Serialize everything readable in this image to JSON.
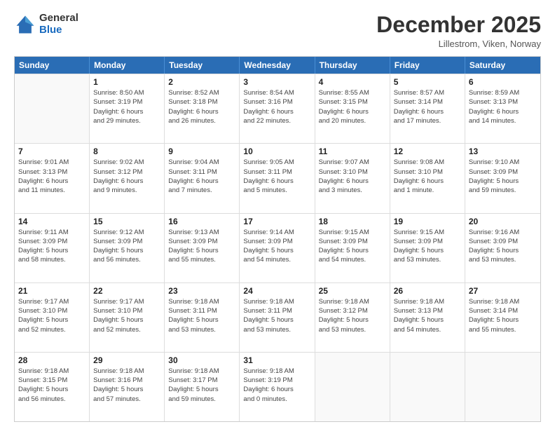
{
  "header": {
    "logo_general": "General",
    "logo_blue": "Blue",
    "month_title": "December 2025",
    "location": "Lillestrom, Viken, Norway"
  },
  "calendar": {
    "days_of_week": [
      "Sunday",
      "Monday",
      "Tuesday",
      "Wednesday",
      "Thursday",
      "Friday",
      "Saturday"
    ],
    "weeks": [
      [
        {
          "day": "",
          "info": ""
        },
        {
          "day": "1",
          "info": "Sunrise: 8:50 AM\nSunset: 3:19 PM\nDaylight: 6 hours\nand 29 minutes."
        },
        {
          "day": "2",
          "info": "Sunrise: 8:52 AM\nSunset: 3:18 PM\nDaylight: 6 hours\nand 26 minutes."
        },
        {
          "day": "3",
          "info": "Sunrise: 8:54 AM\nSunset: 3:16 PM\nDaylight: 6 hours\nand 22 minutes."
        },
        {
          "day": "4",
          "info": "Sunrise: 8:55 AM\nSunset: 3:15 PM\nDaylight: 6 hours\nand 20 minutes."
        },
        {
          "day": "5",
          "info": "Sunrise: 8:57 AM\nSunset: 3:14 PM\nDaylight: 6 hours\nand 17 minutes."
        },
        {
          "day": "6",
          "info": "Sunrise: 8:59 AM\nSunset: 3:13 PM\nDaylight: 6 hours\nand 14 minutes."
        }
      ],
      [
        {
          "day": "7",
          "info": "Sunrise: 9:01 AM\nSunset: 3:13 PM\nDaylight: 6 hours\nand 11 minutes."
        },
        {
          "day": "8",
          "info": "Sunrise: 9:02 AM\nSunset: 3:12 PM\nDaylight: 6 hours\nand 9 minutes."
        },
        {
          "day": "9",
          "info": "Sunrise: 9:04 AM\nSunset: 3:11 PM\nDaylight: 6 hours\nand 7 minutes."
        },
        {
          "day": "10",
          "info": "Sunrise: 9:05 AM\nSunset: 3:11 PM\nDaylight: 6 hours\nand 5 minutes."
        },
        {
          "day": "11",
          "info": "Sunrise: 9:07 AM\nSunset: 3:10 PM\nDaylight: 6 hours\nand 3 minutes."
        },
        {
          "day": "12",
          "info": "Sunrise: 9:08 AM\nSunset: 3:10 PM\nDaylight: 6 hours\nand 1 minute."
        },
        {
          "day": "13",
          "info": "Sunrise: 9:10 AM\nSunset: 3:09 PM\nDaylight: 5 hours\nand 59 minutes."
        }
      ],
      [
        {
          "day": "14",
          "info": "Sunrise: 9:11 AM\nSunset: 3:09 PM\nDaylight: 5 hours\nand 58 minutes."
        },
        {
          "day": "15",
          "info": "Sunrise: 9:12 AM\nSunset: 3:09 PM\nDaylight: 5 hours\nand 56 minutes."
        },
        {
          "day": "16",
          "info": "Sunrise: 9:13 AM\nSunset: 3:09 PM\nDaylight: 5 hours\nand 55 minutes."
        },
        {
          "day": "17",
          "info": "Sunrise: 9:14 AM\nSunset: 3:09 PM\nDaylight: 5 hours\nand 54 minutes."
        },
        {
          "day": "18",
          "info": "Sunrise: 9:15 AM\nSunset: 3:09 PM\nDaylight: 5 hours\nand 54 minutes."
        },
        {
          "day": "19",
          "info": "Sunrise: 9:15 AM\nSunset: 3:09 PM\nDaylight: 5 hours\nand 53 minutes."
        },
        {
          "day": "20",
          "info": "Sunrise: 9:16 AM\nSunset: 3:09 PM\nDaylight: 5 hours\nand 53 minutes."
        }
      ],
      [
        {
          "day": "21",
          "info": "Sunrise: 9:17 AM\nSunset: 3:10 PM\nDaylight: 5 hours\nand 52 minutes."
        },
        {
          "day": "22",
          "info": "Sunrise: 9:17 AM\nSunset: 3:10 PM\nDaylight: 5 hours\nand 52 minutes."
        },
        {
          "day": "23",
          "info": "Sunrise: 9:18 AM\nSunset: 3:11 PM\nDaylight: 5 hours\nand 53 minutes."
        },
        {
          "day": "24",
          "info": "Sunrise: 9:18 AM\nSunset: 3:11 PM\nDaylight: 5 hours\nand 53 minutes."
        },
        {
          "day": "25",
          "info": "Sunrise: 9:18 AM\nSunset: 3:12 PM\nDaylight: 5 hours\nand 53 minutes."
        },
        {
          "day": "26",
          "info": "Sunrise: 9:18 AM\nSunset: 3:13 PM\nDaylight: 5 hours\nand 54 minutes."
        },
        {
          "day": "27",
          "info": "Sunrise: 9:18 AM\nSunset: 3:14 PM\nDaylight: 5 hours\nand 55 minutes."
        }
      ],
      [
        {
          "day": "28",
          "info": "Sunrise: 9:18 AM\nSunset: 3:15 PM\nDaylight: 5 hours\nand 56 minutes."
        },
        {
          "day": "29",
          "info": "Sunrise: 9:18 AM\nSunset: 3:16 PM\nDaylight: 5 hours\nand 57 minutes."
        },
        {
          "day": "30",
          "info": "Sunrise: 9:18 AM\nSunset: 3:17 PM\nDaylight: 5 hours\nand 59 minutes."
        },
        {
          "day": "31",
          "info": "Sunrise: 9:18 AM\nSunset: 3:19 PM\nDaylight: 6 hours\nand 0 minutes."
        },
        {
          "day": "",
          "info": ""
        },
        {
          "day": "",
          "info": ""
        },
        {
          "day": "",
          "info": ""
        }
      ]
    ]
  }
}
